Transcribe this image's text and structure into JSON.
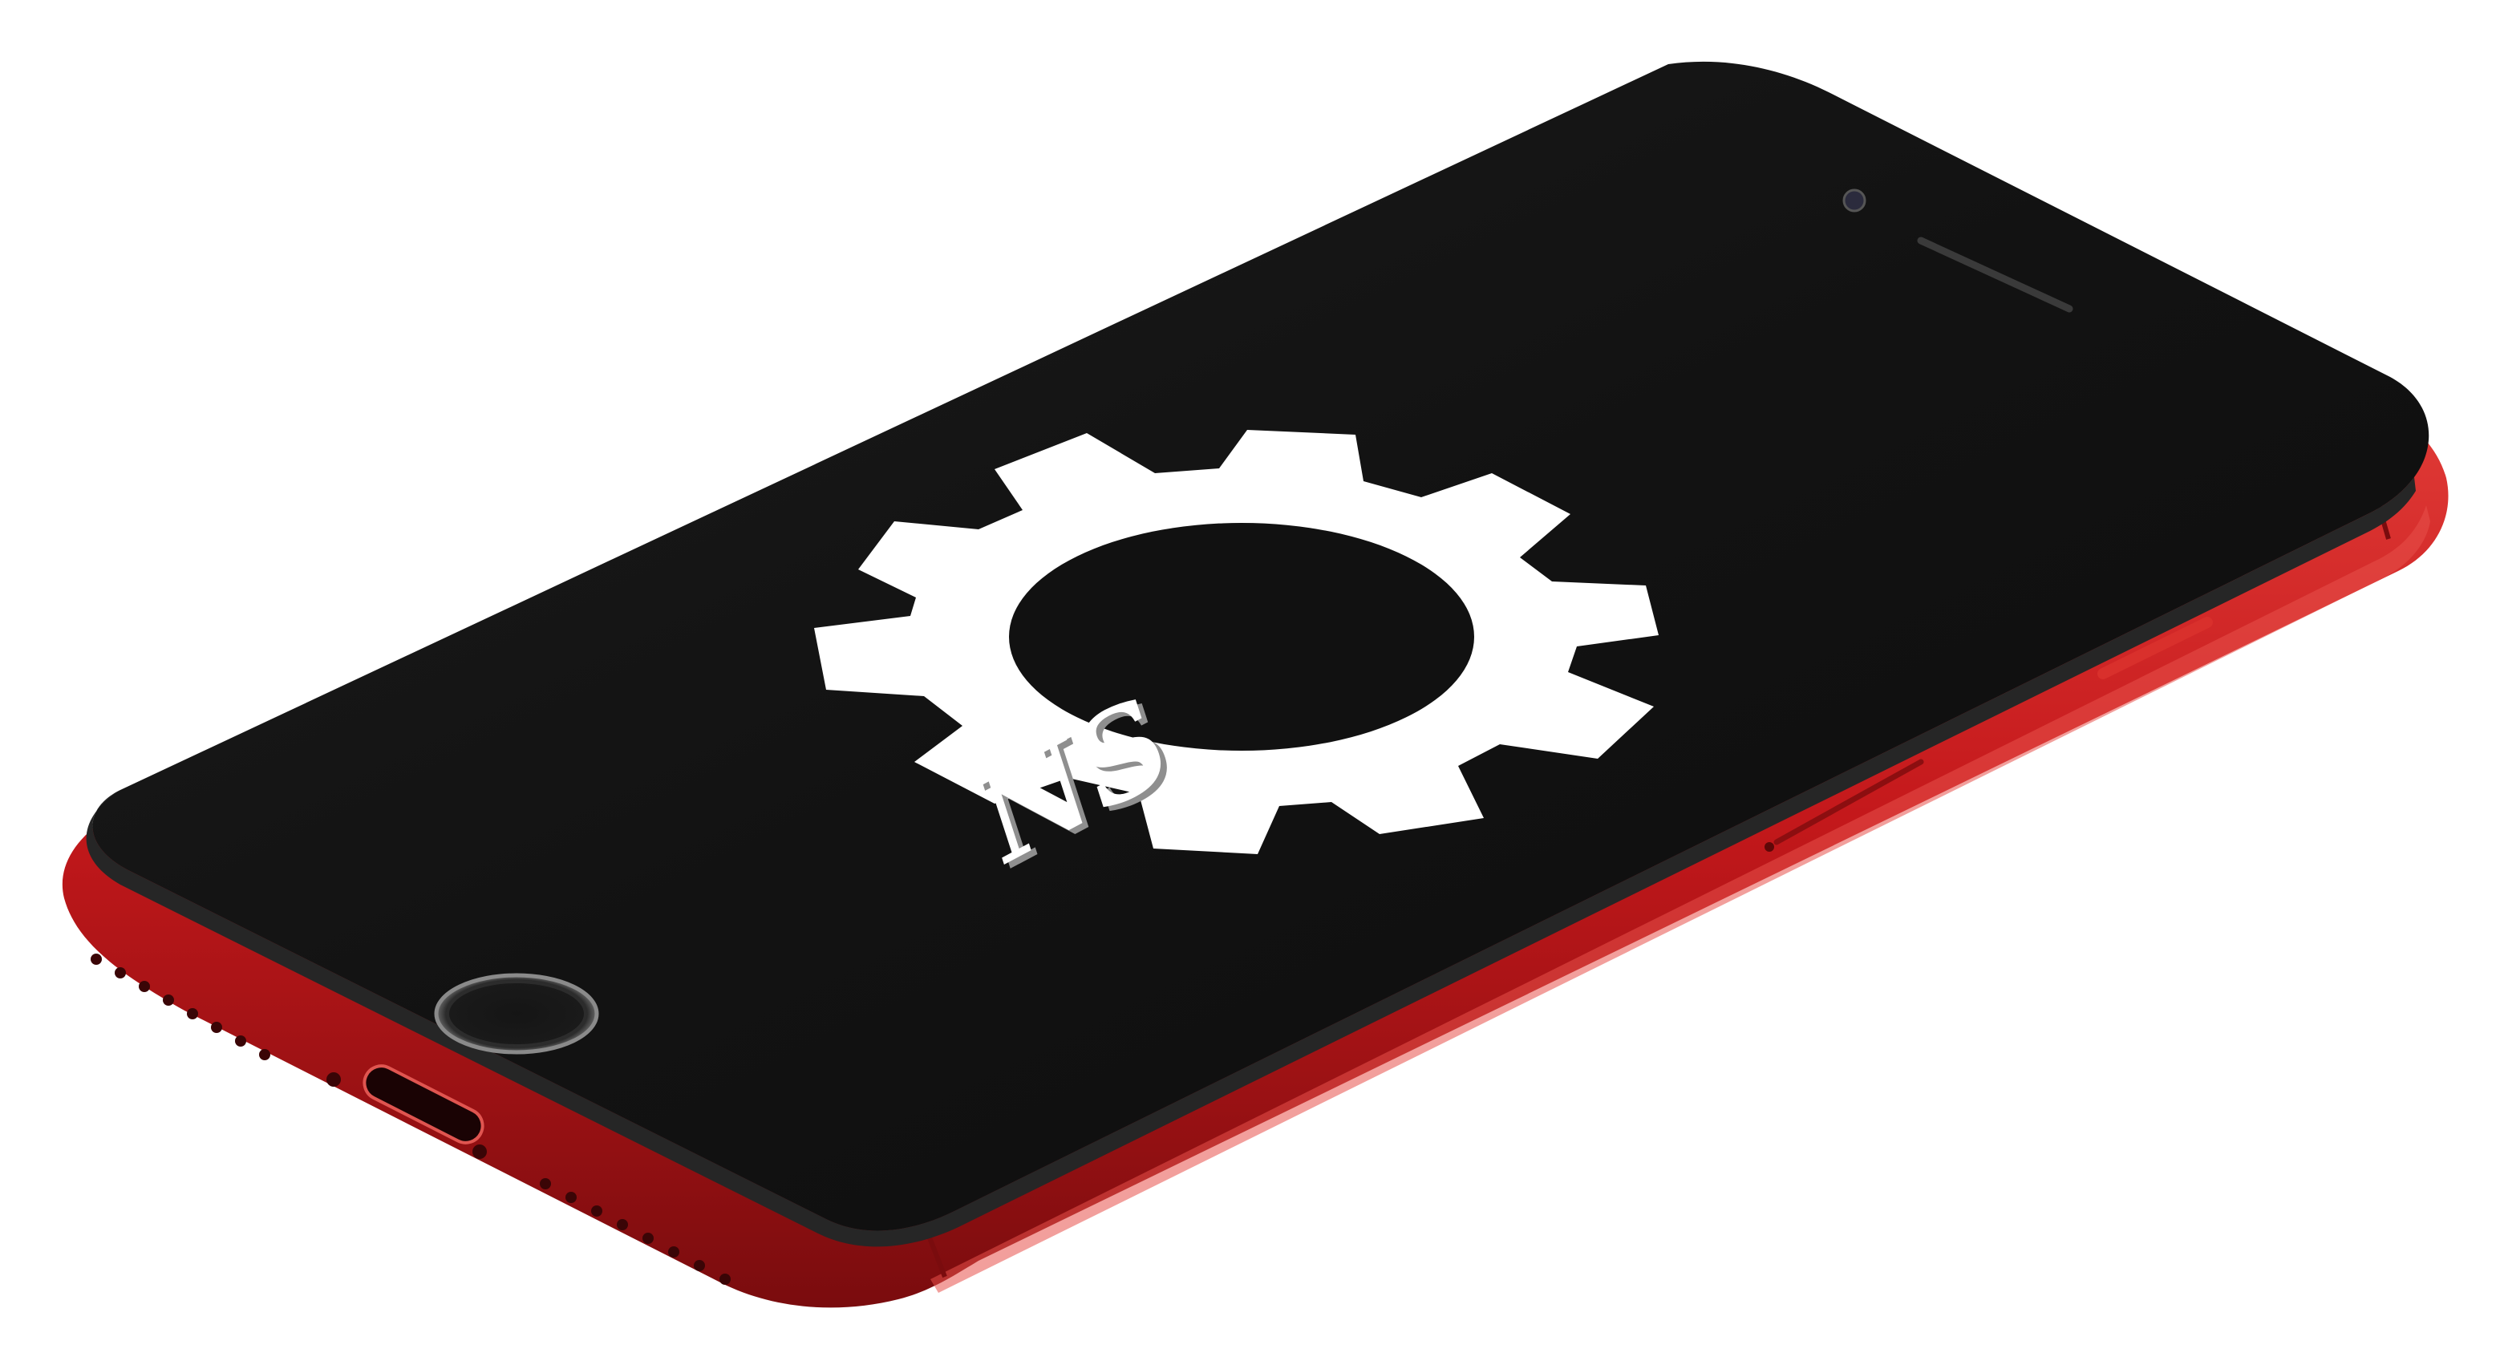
{
  "scene": {
    "description_kind": "product-render",
    "device": "smartphone",
    "frame_color": "#c4181b",
    "frame_highlight": "#e8514a",
    "frame_shadow": "#6e0a0c",
    "glass_color": "#121212",
    "glass_edge_color": "#2a2a2a",
    "background_color": "#ffffff"
  },
  "screen": {
    "logo": {
      "icon": "gear-logo-icon",
      "text": "NS",
      "color": "#ffffff",
      "inner_color": "#111111"
    }
  }
}
